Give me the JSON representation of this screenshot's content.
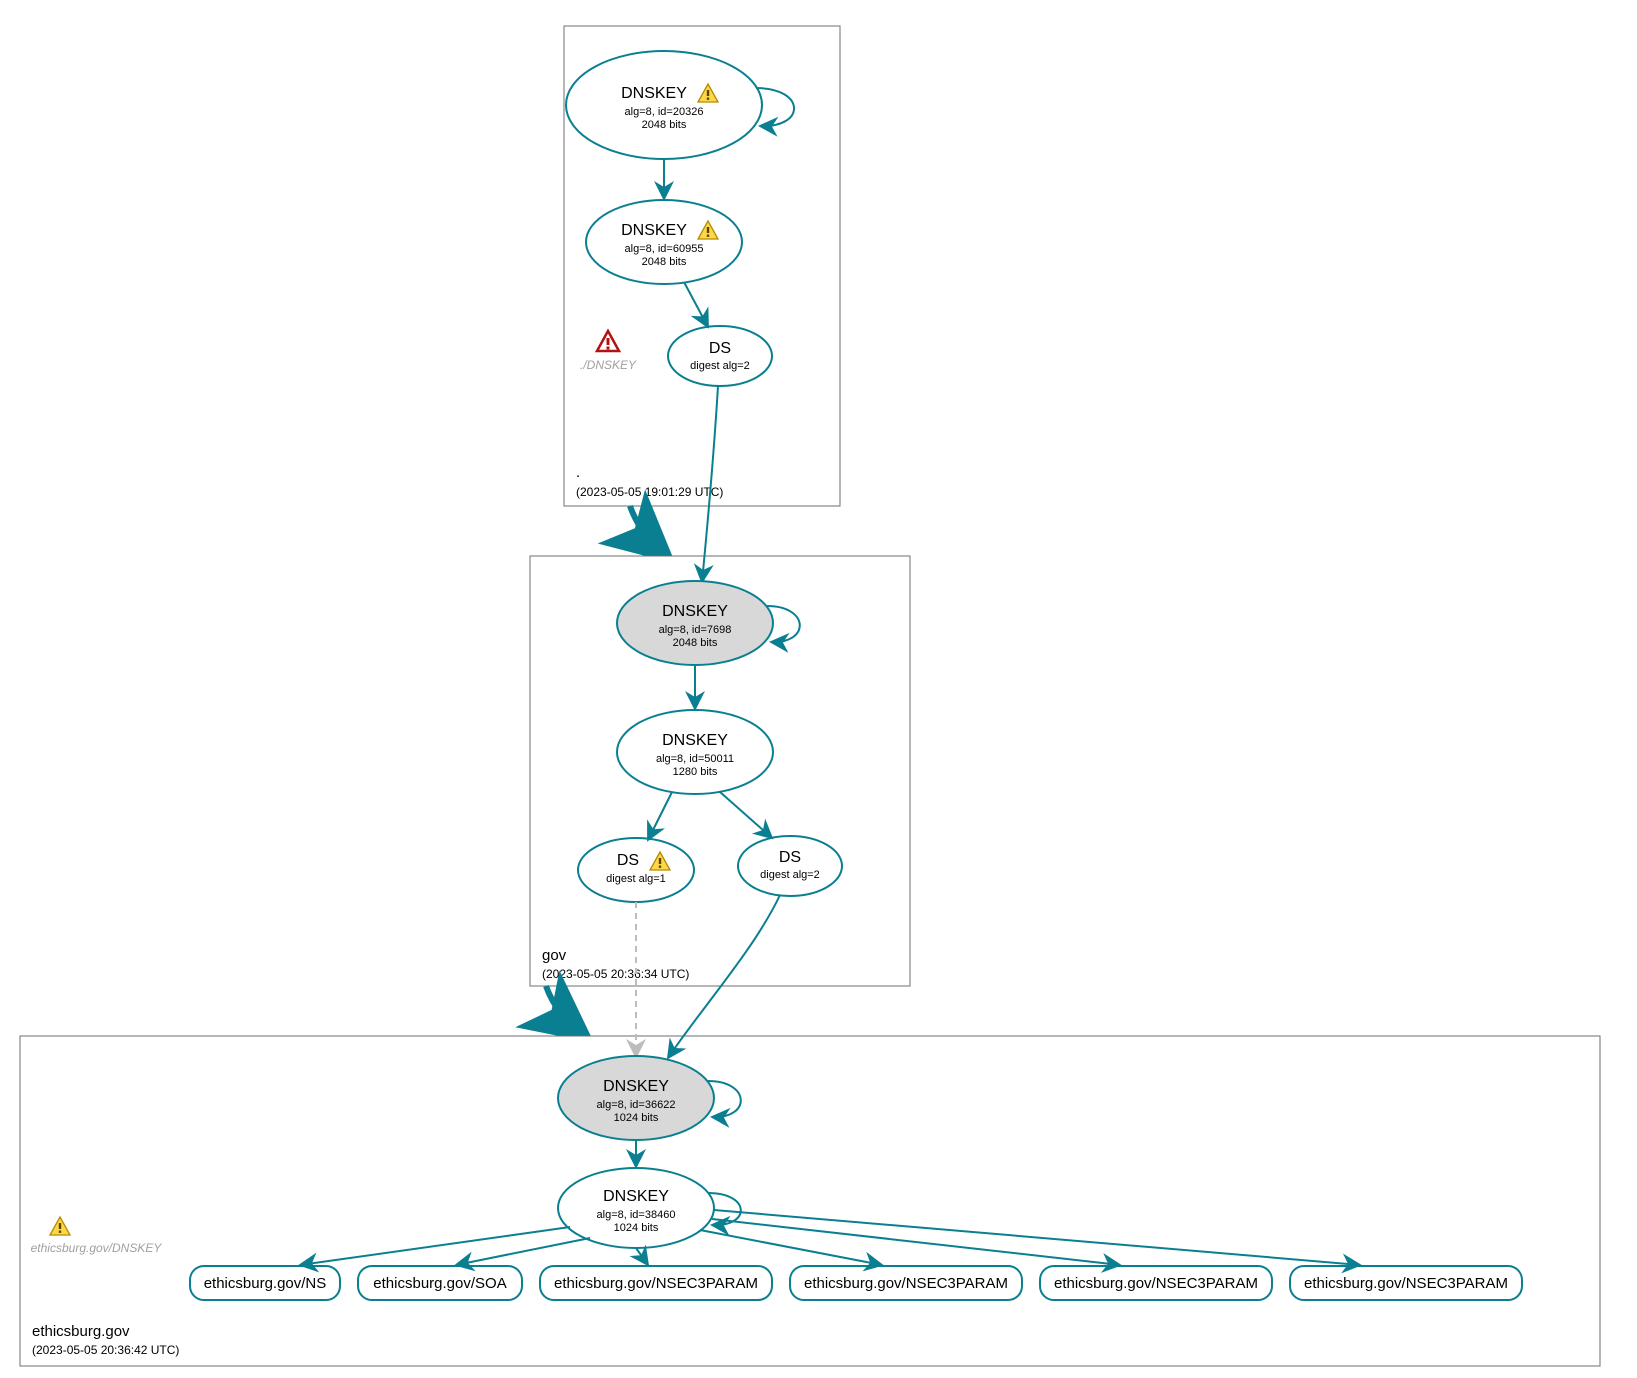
{
  "colors": {
    "stroke": "#0a7f91",
    "zone_border": "#6f6f6f",
    "ksk_fill": "#d8d8d8",
    "dash": "#bcbcbc"
  },
  "zones": {
    "root": {
      "name": ".",
      "timestamp": "(2023-05-05 19:01:29 UTC)",
      "dnskey_ksk": {
        "title": "DNSKEY",
        "sub1": "alg=8, id=20326",
        "sub2": "2048 bits",
        "warn": true
      },
      "dnskey_zsk": {
        "title": "DNSKEY",
        "sub1": "alg=8, id=60955",
        "sub2": "2048 bits",
        "warn": true
      },
      "ds": {
        "title": "DS",
        "sub": "digest alg=2"
      },
      "placeholder": {
        "label": "./DNSKEY",
        "error": true
      }
    },
    "gov": {
      "name": "gov",
      "timestamp": "(2023-05-05 20:36:34 UTC)",
      "dnskey_ksk": {
        "title": "DNSKEY",
        "sub1": "alg=8, id=7698",
        "sub2": "2048 bits"
      },
      "dnskey_zsk": {
        "title": "DNSKEY",
        "sub1": "alg=8, id=50011",
        "sub2": "1280 bits"
      },
      "ds1": {
        "title": "DS",
        "sub": "digest alg=1",
        "warn": true
      },
      "ds2": {
        "title": "DS",
        "sub": "digest alg=2"
      }
    },
    "ethicsburg": {
      "name": "ethicsburg.gov",
      "timestamp": "(2023-05-05 20:36:42 UTC)",
      "dnskey_ksk": {
        "title": "DNSKEY",
        "sub1": "alg=8, id=36622",
        "sub2": "1024 bits"
      },
      "dnskey_zsk": {
        "title": "DNSKEY",
        "sub1": "alg=8, id=38460",
        "sub2": "1024 bits"
      },
      "placeholder": {
        "label": "ethicsburg.gov/DNSKEY",
        "warn": true
      },
      "rr": [
        "ethicsburg.gov/NS",
        "ethicsburg.gov/SOA",
        "ethicsburg.gov/NSEC3PARAM",
        "ethicsburg.gov/NSEC3PARAM",
        "ethicsburg.gov/NSEC3PARAM",
        "ethicsburg.gov/NSEC3PARAM"
      ]
    }
  },
  "icons": {
    "warn": "warning-icon",
    "error": "error-icon"
  }
}
